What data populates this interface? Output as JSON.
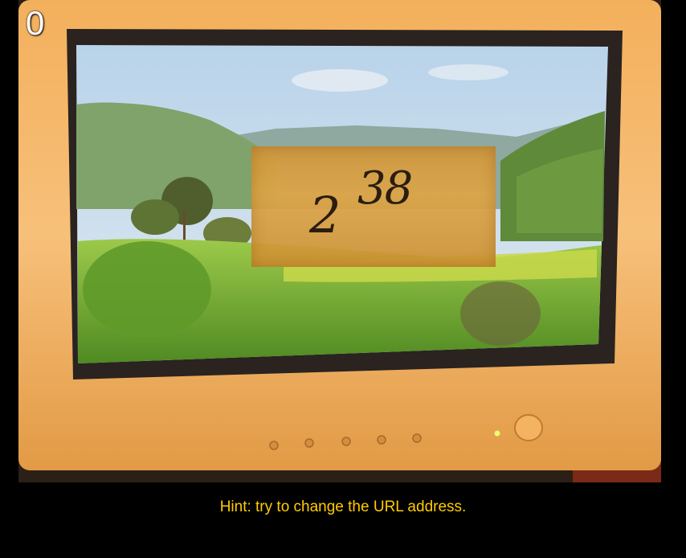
{
  "level": {
    "number": "0"
  },
  "puzzle": {
    "base": "2",
    "exponent": "38"
  },
  "hint": {
    "text": "Hint: try to change the URL address."
  },
  "colors": {
    "hint": "#ffcc00",
    "background": "#000000"
  }
}
